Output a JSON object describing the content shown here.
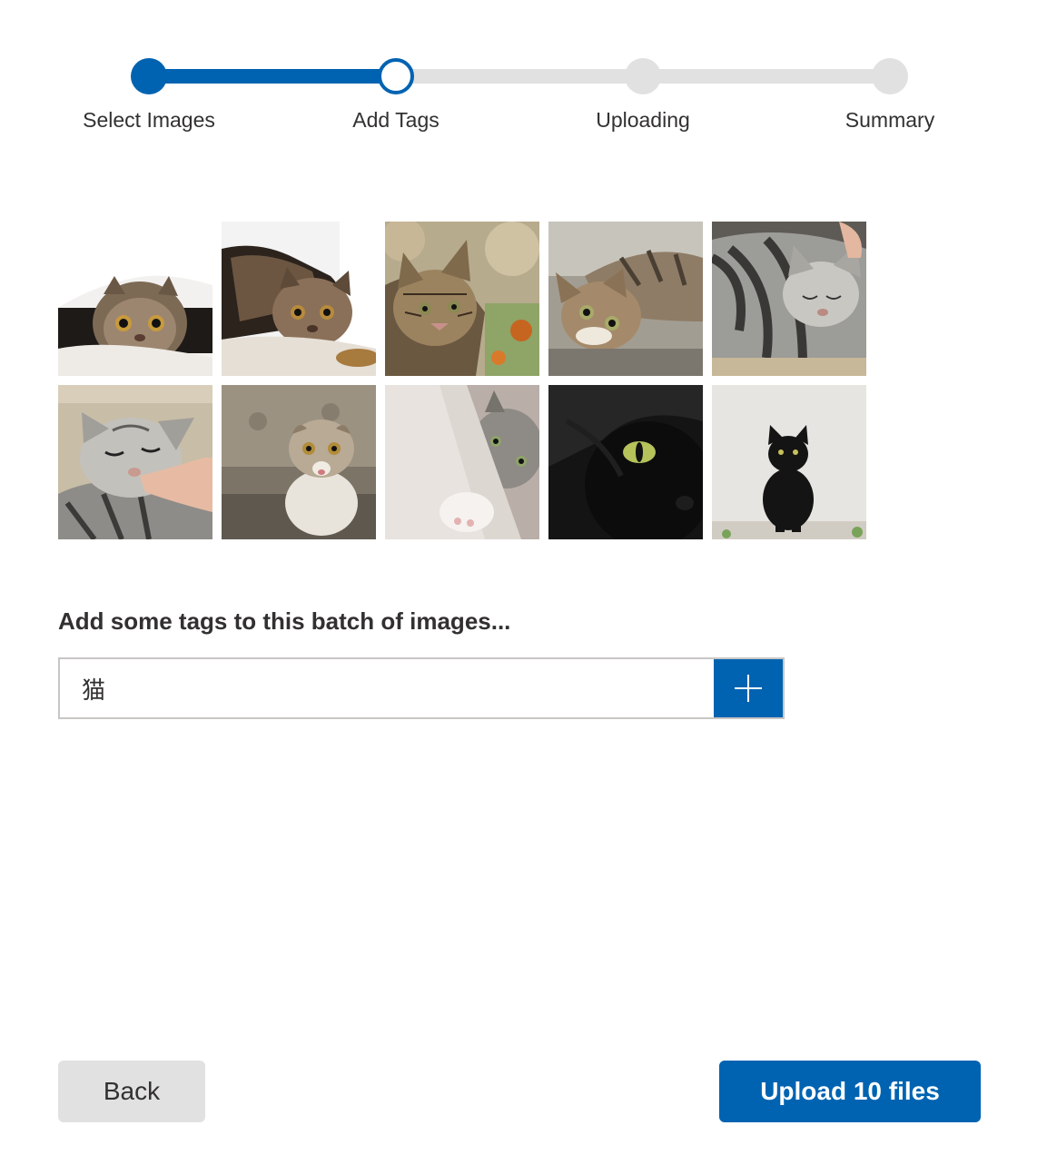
{
  "stepper": {
    "current_step": 2,
    "steps": [
      {
        "label": "Select Images",
        "state": "done"
      },
      {
        "label": "Add Tags",
        "state": "current"
      },
      {
        "label": "Uploading",
        "state": "todo"
      },
      {
        "label": "Summary",
        "state": "todo"
      }
    ]
  },
  "images": {
    "count": 10,
    "items": [
      {
        "subject": "exotic-shorthair-cat-under-blanket"
      },
      {
        "subject": "exotic-shorthair-cat-lying"
      },
      {
        "subject": "tabby-kitten-outdoors"
      },
      {
        "subject": "tabby-cat-lying-on-ground"
      },
      {
        "subject": "silver-tabby-cat-being-petted"
      },
      {
        "subject": "silver-tabby-cat-chin-scratch"
      },
      {
        "subject": "scottish-fold-kitten"
      },
      {
        "subject": "grey-white-kitten-peeking"
      },
      {
        "subject": "black-cat-closeup"
      },
      {
        "subject": "black-cat-sitting"
      }
    ]
  },
  "tags": {
    "heading": "Add some tags to this batch of images...",
    "input_value": "猫",
    "add_button_icon": "plus-icon"
  },
  "actions": {
    "back_label": "Back",
    "upload_label": "Upload 10 files"
  },
  "colors": {
    "accent": "#0063b1",
    "track": "#e1e1e1",
    "text": "#323130",
    "secondary_button": "#e1e1e1"
  }
}
